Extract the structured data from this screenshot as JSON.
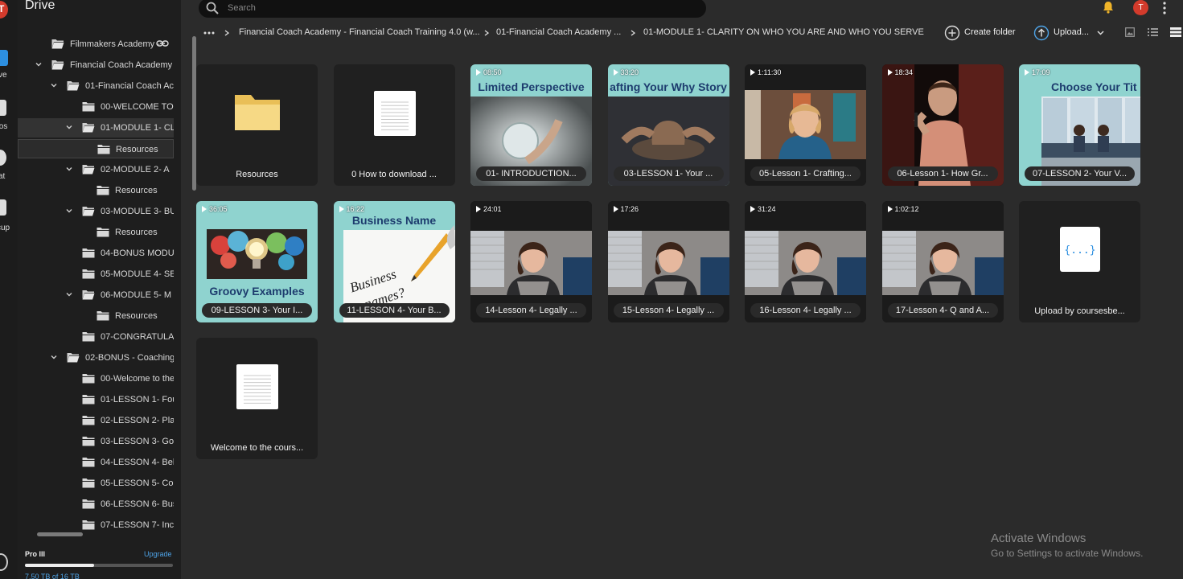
{
  "sidebar": {
    "title": "Drive",
    "tree": [
      {
        "label": "Filmmakers Academy -",
        "level": 1,
        "expander": "none",
        "folder": "open",
        "link_icon": true
      },
      {
        "label": "Financial Coach Academy -",
        "level": 1,
        "expander": "down",
        "folder": "open"
      },
      {
        "label": "01-Financial Coach Aca",
        "level": 2,
        "expander": "down",
        "folder": "open"
      },
      {
        "label": "00-WELCOME TO",
        "level": 3,
        "expander": "none",
        "folder": "closed"
      },
      {
        "label": "01-MODULE 1- CL",
        "level": 3,
        "expander": "down",
        "folder": "open",
        "state": "selected"
      },
      {
        "label": "Resources",
        "level": 4,
        "expander": "none",
        "folder": "closed",
        "state": "hover"
      },
      {
        "label": "02-MODULE 2- A",
        "level": 3,
        "expander": "down",
        "folder": "open"
      },
      {
        "label": "Resources",
        "level": 4,
        "expander": "none",
        "folder": "closed"
      },
      {
        "label": "03-MODULE 3- BU",
        "level": 3,
        "expander": "down",
        "folder": "open"
      },
      {
        "label": "Resources",
        "level": 4,
        "expander": "none",
        "folder": "closed"
      },
      {
        "label": "04-BONUS MODU",
        "level": 3,
        "expander": "none",
        "folder": "closed"
      },
      {
        "label": "05-MODULE 4- SE",
        "level": 3,
        "expander": "none",
        "folder": "closed"
      },
      {
        "label": "06-MODULE 5- M",
        "level": 3,
        "expander": "down",
        "folder": "open"
      },
      {
        "label": "Resources",
        "level": 4,
        "expander": "none",
        "folder": "closed"
      },
      {
        "label": "07-CONGRATULA",
        "level": 3,
        "expander": "none",
        "folder": "closed"
      },
      {
        "label": "02-BONUS - Coaching",
        "level": 2,
        "expander": "down",
        "folder": "open"
      },
      {
        "label": "00-Welcome to the",
        "level": 3,
        "expander": "none",
        "folder": "closed"
      },
      {
        "label": "01-LESSON 1- Fou",
        "level": 3,
        "expander": "none",
        "folder": "closed"
      },
      {
        "label": "02-LESSON 2- Plan",
        "level": 3,
        "expander": "none",
        "folder": "closed"
      },
      {
        "label": "03-LESSON 3- Goa",
        "level": 3,
        "expander": "none",
        "folder": "closed"
      },
      {
        "label": "04-LESSON 4- Beh",
        "level": 3,
        "expander": "none",
        "folder": "closed"
      },
      {
        "label": "05-LESSON 5- Cou",
        "level": 3,
        "expander": "none",
        "folder": "closed"
      },
      {
        "label": "06-LESSON 6- Bus",
        "level": 3,
        "expander": "none",
        "folder": "closed"
      },
      {
        "label": "07-LESSON 7- Inc",
        "level": 3,
        "expander": "none",
        "folder": "closed"
      }
    ],
    "plan": "Pro III",
    "upgrade": "Upgrade",
    "storage_text": "7.50 TB of 16 TB",
    "storage_fraction": 0.47
  },
  "rail": {
    "logo_letter": "T",
    "items": [
      "ve",
      "tos",
      "at",
      "cup"
    ]
  },
  "search": {
    "placeholder": "Search"
  },
  "header": {
    "avatar_letter": "T",
    "breadcrumbs": [
      "Financial Coach Academy - Financial Coach Training 4.0 (w...",
      "01-Financial Coach Academy ...",
      "01-MODULE 1- CLARITY ON WHO YOU ARE AND WHO YOU SERVE"
    ],
    "create_folder": "Create folder",
    "upload": "Upload..."
  },
  "items": [
    {
      "type": "folder",
      "name": "Resources"
    },
    {
      "type": "doc",
      "name": "0 How to download ..."
    },
    {
      "type": "video",
      "name": "01- INTRODUCTION...",
      "duration": "08:50",
      "thumb": "crystal",
      "thumb_title": "Limited Perspective"
    },
    {
      "type": "video",
      "name": "03-LESSON 1- Your ...",
      "duration": "33:20",
      "thumb": "pottery",
      "thumb_title": "afting Your Why Story"
    },
    {
      "type": "video",
      "name": "05-Lesson 1- Crafting...",
      "duration": "1:11:30",
      "thumb": "webcam-blonde"
    },
    {
      "type": "video",
      "name": "06-Lesson 1- How Gr...",
      "duration": "18:34",
      "thumb": "man-stage"
    },
    {
      "type": "video",
      "name": "07-LESSON 2- Your V...",
      "duration": "17:09",
      "thumb": "office",
      "thumb_title": "Choose Your Tit"
    },
    {
      "type": "video",
      "name": "09-LESSON 3- Your I...",
      "duration": "36:05",
      "thumb": "bulb",
      "thumb_title": "Groovy Examples"
    },
    {
      "type": "video",
      "name": "11-LESSON 4- Your B...",
      "duration": "16:22",
      "thumb": "business",
      "thumb_title": "Business Name"
    },
    {
      "type": "video",
      "name": "14-Lesson 4- Legally ...",
      "duration": "24:01",
      "thumb": "webcam-brunette"
    },
    {
      "type": "video",
      "name": "15-Lesson 4- Legally ...",
      "duration": "17:26",
      "thumb": "webcam-brunette"
    },
    {
      "type": "video",
      "name": "16-Lesson 4- Legally ...",
      "duration": "31:24",
      "thumb": "webcam-brunette"
    },
    {
      "type": "video",
      "name": "17-Lesson 4- Q and A...",
      "duration": "1:02:12",
      "thumb": "webcam-brunette"
    },
    {
      "type": "json",
      "name": "Upload by coursesbe..."
    },
    {
      "type": "doc",
      "name": "Welcome to the cours..."
    }
  ],
  "watermark": {
    "line1": "Activate Windows",
    "line2": "Go to Settings to activate Windows."
  },
  "colors": {
    "accent": "#4ea3e6",
    "avatar": "#d33b2c",
    "folder": "#f5d77e",
    "thumb_teal": "#8fd3cf"
  }
}
